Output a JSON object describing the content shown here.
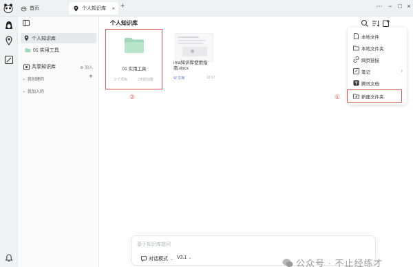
{
  "tabs": [
    {
      "label": "首页"
    },
    {
      "label": "个人知识库"
    }
  ],
  "sidebar": {
    "personal_kb": "个人知识库",
    "folder": "01 实用工具",
    "shared_kb": "共享知识库",
    "join": "加入",
    "my_created": "我创建的",
    "my_joined": "我加入的"
  },
  "main": {
    "title": "个人知识库",
    "cards": [
      {
        "name": "01 实用工具",
        "meta_left": "0 个项目",
        "meta_right": "2天前创建"
      },
      {
        "name": "ima知识库使用指南.docx",
        "meta_left": "W 文档",
        "meta_right": "10:17"
      }
    ],
    "marker_2": "②",
    "marker_1": "①"
  },
  "menu": {
    "items": [
      {
        "label": "本地文件"
      },
      {
        "label": "本地文件夹"
      },
      {
        "label": "网页链接"
      },
      {
        "label": "笔记"
      },
      {
        "label": "腾讯文档"
      },
      {
        "label": "新建文件夹"
      }
    ]
  },
  "chat": {
    "placeholder": "基于知识库提问",
    "mode": "对话模式",
    "version": "V3.1"
  },
  "watermark": "公众号 · 不止经练才",
  "colors": {
    "accent_green": "#9ed8b8",
    "highlight_red": "#e15050"
  }
}
